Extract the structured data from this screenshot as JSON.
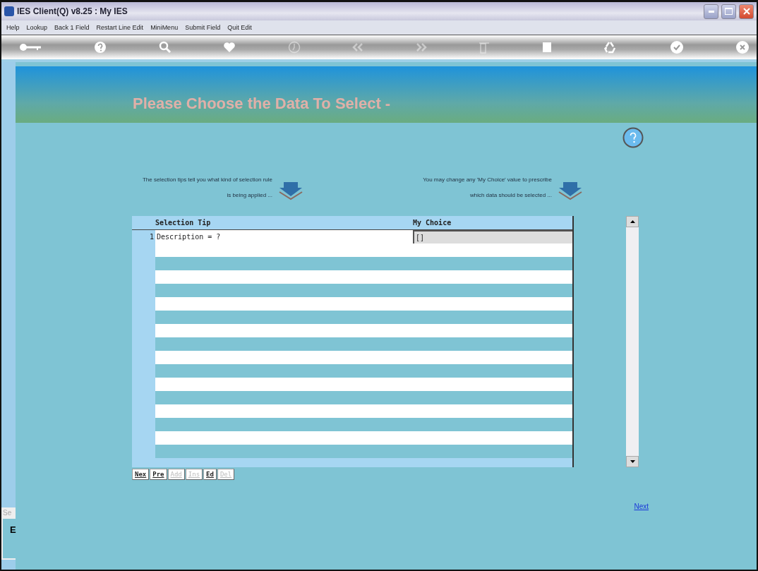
{
  "window": {
    "title": "IES Client(Q) v8.25 : My IES"
  },
  "menu": [
    "Help",
    "Lookup",
    "Back 1 Field",
    "Restart Line Edit",
    "MiniMenu",
    "Submit Field",
    "Quit Edit"
  ],
  "toolbar": [
    {
      "kind": "key",
      "disabled": false
    },
    {
      "kind": "help",
      "disabled": false
    },
    {
      "kind": "search",
      "disabled": false
    },
    {
      "kind": "heart",
      "disabled": false
    },
    {
      "kind": "clock",
      "disabled": true
    },
    {
      "kind": "back",
      "disabled": true
    },
    {
      "kind": "forward",
      "disabled": true
    },
    {
      "kind": "bin",
      "disabled": true
    },
    {
      "kind": "square",
      "disabled": false
    },
    {
      "kind": "recycle",
      "disabled": false
    },
    {
      "kind": "check",
      "disabled": false
    },
    {
      "kind": "close",
      "disabled": false
    }
  ],
  "heading": "Please Choose the Data To Select -",
  "tips": {
    "left": "The selection tips tell you what kind of selection rule is being applied ...",
    "right": "You may change any 'My Choice' value to prescribe which data should be selected ..."
  },
  "table": {
    "columns": [
      "Selection Tip",
      "My Choice"
    ],
    "rows": [
      {
        "number": "1",
        "tip": "Description = ?",
        "choice": "[]"
      }
    ]
  },
  "row_buttons": [
    {
      "label": "Nex",
      "disabled": false
    },
    {
      "label": "Pre",
      "disabled": false
    },
    {
      "label": "Add",
      "disabled": true
    },
    {
      "label": "Ins",
      "disabled": true
    },
    {
      "label": "Ed",
      "disabled": false
    },
    {
      "label": "Del",
      "disabled": true
    }
  ],
  "next_link": "Next",
  "side_panel": {
    "label": "Se",
    "value": "E"
  }
}
